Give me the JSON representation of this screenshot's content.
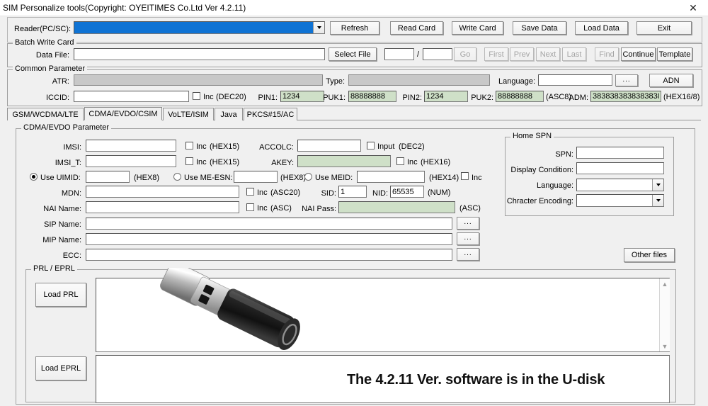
{
  "window": {
    "title": "SIM Personalize tools(Copyright: OYEITIMES Co.Ltd  Ver 4.2.11)",
    "close_icon": "close-icon"
  },
  "reader": {
    "label": "Reader(PC/SC):",
    "value": "",
    "buttons": [
      {
        "label": "Refresh",
        "enabled": true
      },
      {
        "label": "Read Card",
        "enabled": true
      },
      {
        "label": "Write Card",
        "enabled": true
      },
      {
        "label": "Save Data",
        "enabled": true
      },
      {
        "label": "Load Data",
        "enabled": true
      },
      {
        "label": "Exit",
        "enabled": true
      }
    ]
  },
  "batch": {
    "group_label": "Batch Write Card",
    "data_file_label": "Data File:",
    "data_file_value": "",
    "select_file_label": "Select File",
    "index_current": "",
    "index_total": "",
    "slash": "/",
    "nav_buttons": [
      {
        "label": "Go",
        "enabled": false
      },
      {
        "label": "First",
        "enabled": false
      },
      {
        "label": "Prev",
        "enabled": false
      },
      {
        "label": "Next",
        "enabled": false
      },
      {
        "label": "Last",
        "enabled": false
      },
      {
        "label": "Find",
        "enabled": false
      },
      {
        "label": "Continue",
        "enabled": true
      },
      {
        "label": "Template",
        "enabled": true
      }
    ]
  },
  "common": {
    "group_label": "Common Parameter",
    "atr_label": "ATR:",
    "atr_value": "",
    "type_label": "Type:",
    "type_value": "",
    "language_label": "Language:",
    "language_value": "",
    "language_browse": "...",
    "adn_label": "ADN",
    "iccid_label": "ICCID:",
    "iccid_value": "",
    "iccid_inc": "Inc",
    "iccid_fmt": "(DEC20)",
    "pin1_label": "PIN1:",
    "pin1_value": "1234",
    "puk1_label": "PUK1:",
    "puk1_value": "88888888",
    "pin2_label": "PIN2:",
    "pin2_value": "1234",
    "puk2_label": "PUK2:",
    "puk2_value": "88888888",
    "puk2_fmt": "(ASC8)",
    "adm_label": "ADM:",
    "adm_value": "3838383838383838",
    "adm_fmt": "(HEX16/8)"
  },
  "tabs": [
    {
      "label": "GSM/WCDMA/LTE",
      "active": false
    },
    {
      "label": "CDMA/EVDO/CSIM",
      "active": true
    },
    {
      "label": "VoLTE/ISIM",
      "active": false
    },
    {
      "label": "Java",
      "active": false
    },
    {
      "label": "PKCS#15/AC",
      "active": false
    }
  ],
  "cdma": {
    "group_label": "CDMA/EVDO Parameter",
    "imsi_label": "IMSI:",
    "imsi_value": "",
    "imsi_inc": "Inc",
    "imsi_fmt": "(HEX15)",
    "imsit_label": "IMSI_T:",
    "imsit_value": "",
    "imsit_inc": "Inc",
    "imsit_fmt": "(HEX15)",
    "accolc_label": "ACCOLC:",
    "accolc_value": "",
    "accolc_input": "Input",
    "accolc_fmt": "(DEC2)",
    "akey_label": "AKEY:",
    "akey_value": "",
    "akey_inc": "Inc",
    "akey_fmt": "(HEX16)",
    "uimid_label": "Use UIMID:",
    "uimid_value": "",
    "uimid_fmt": "(HEX8)",
    "uimid_selected": true,
    "meesn_label": "Use ME-ESN:",
    "meesn_value": "",
    "meesn_fmt": "(HEX8)",
    "meid_label": "Use MEID:",
    "meid_value": "",
    "meid_fmt": "(HEX14)",
    "meid_inc": "Inc",
    "mdn_label": "MDN:",
    "mdn_value": "",
    "mdn_inc": "Inc",
    "mdn_fmt": "(ASC20)",
    "sid_label": "SID:",
    "sid_value": "1",
    "nid_label": "NID:",
    "nid_value": "65535",
    "nid_fmt": "(NUM)",
    "nai_name_label": "NAI Name:",
    "nai_name_value": "",
    "nai_name_inc": "Inc",
    "nai_name_fmt": "(ASC)",
    "nai_pass_label": "NAI Pass:",
    "nai_pass_value": "",
    "nai_pass_fmt": "(ASC)",
    "sip_label": "SIP Name:",
    "sip_value": "",
    "mip_label": "MIP Name:",
    "mip_value": "",
    "ecc_label": "ECC:",
    "ecc_value": "",
    "browse": "...",
    "other_files_label": "Other files"
  },
  "home_spn": {
    "group_label": "Home SPN",
    "spn_label": "SPN:",
    "spn_value": "",
    "display_condition_label": "Display Condition:",
    "display_condition_value": "",
    "language_label": "Language:",
    "language_value": "",
    "encoding_label": "Chracter Encoding:",
    "encoding_value": ""
  },
  "prl": {
    "group_label": "PRL / EPRL",
    "load_prl_label": "Load PRL",
    "load_eprl_label": "Load EPRL",
    "prl_text": "",
    "eprl_text": ""
  },
  "overlay": {
    "message": "The 4.2.11 Ver. software is in the U-disk"
  }
}
